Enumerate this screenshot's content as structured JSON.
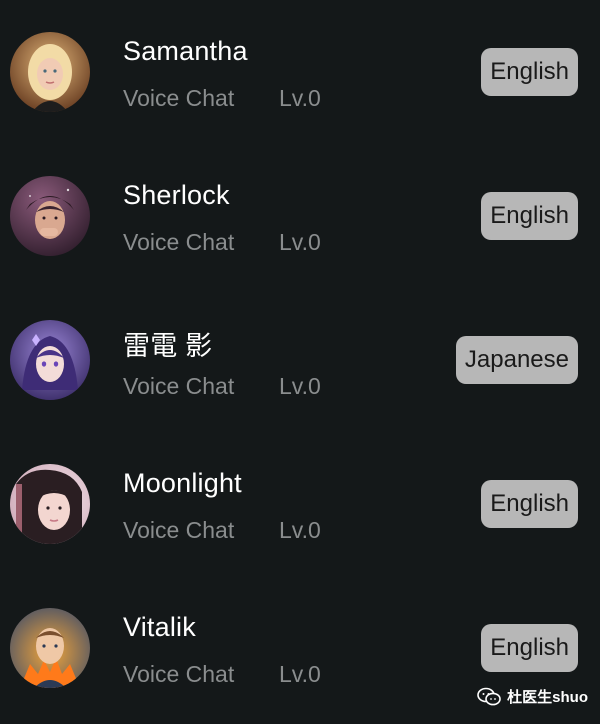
{
  "contacts": [
    {
      "name": "Samantha",
      "mode": "Voice Chat",
      "level": "Lv.0",
      "language": "English",
      "avatar_icon": "avatar-samantha"
    },
    {
      "name": "Sherlock",
      "mode": "Voice Chat",
      "level": "Lv.0",
      "language": "English",
      "avatar_icon": "avatar-sherlock"
    },
    {
      "name": "雷電 影",
      "mode": "Voice Chat",
      "level": "Lv.0",
      "language": "Japanese",
      "avatar_icon": "avatar-raiden-ei"
    },
    {
      "name": "Moonlight",
      "mode": "Voice Chat",
      "level": "Lv.0",
      "language": "English",
      "avatar_icon": "avatar-moonlight"
    },
    {
      "name": "Vitalik",
      "mode": "Voice Chat",
      "level": "Lv.0",
      "language": "English",
      "avatar_icon": "avatar-vitalik"
    }
  ],
  "watermark": {
    "text": "杜医生shuo",
    "icon": "wechat-icon"
  },
  "colors": {
    "background": "#141819",
    "badge": "#b7b7b7",
    "secondary_text": "#8a8d8e"
  }
}
